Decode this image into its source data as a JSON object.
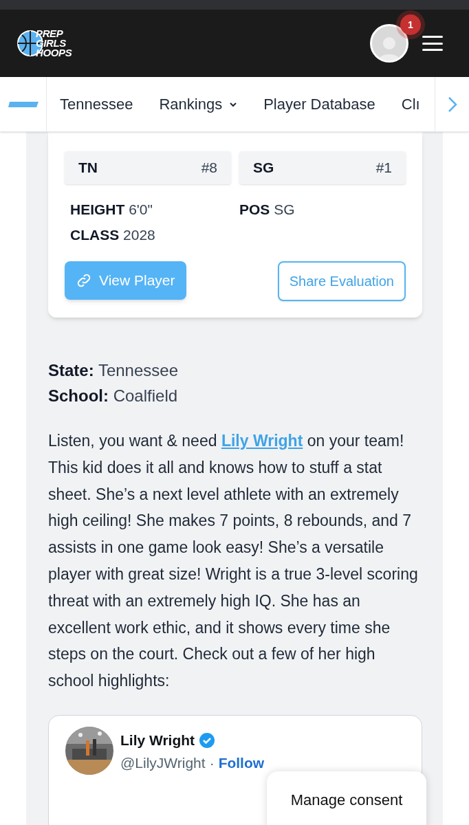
{
  "header": {
    "logo_lines": [
      "PREP",
      "GIRLS",
      "HOOPS"
    ],
    "notification_count": "1"
  },
  "nav": {
    "items": [
      {
        "label": "Tennessee",
        "dropdown": false
      },
      {
        "label": "Rankings",
        "dropdown": true
      },
      {
        "label": "Player Database",
        "dropdown": false
      },
      {
        "label": "Clı",
        "dropdown": false
      }
    ]
  },
  "player_card": {
    "ranks": [
      {
        "label": "TN",
        "rank": "#8"
      },
      {
        "label": "SG",
        "rank": "#1"
      }
    ],
    "stats": [
      {
        "label": "HEIGHT",
        "value": "6'0\""
      },
      {
        "label": "POS",
        "value": "SG"
      },
      {
        "label": "CLASS",
        "value": "2028"
      }
    ],
    "view_button": "View Player",
    "share_button": "Share Evaluation"
  },
  "details": [
    {
      "label": "State:",
      "value": "Tennessee"
    },
    {
      "label": "School:",
      "value": "Coalfield"
    }
  ],
  "article": {
    "before": "Listen, you want & need ",
    "link": "Lily Wright",
    "after": " on your team! This kid does it all and knows how to stuff a stat sheet. She’s a next level athlete with an extremely high ceiling! She makes 7 points, 8 rebounds, and 7 assists in one game look easy! She’s a versatile player with great size! Wright is a true 3-level scoring threat with an extremely high IQ. She has an excellent work ethic, and it shows every time she steps on the court. Check out a few of her high school highlights:"
  },
  "tweet": {
    "name": "Lily Wright",
    "verified": true,
    "handle": "@LilyJWright",
    "separator": "·",
    "follow": "Follow"
  },
  "consent": {
    "label": "Manage consent"
  }
}
